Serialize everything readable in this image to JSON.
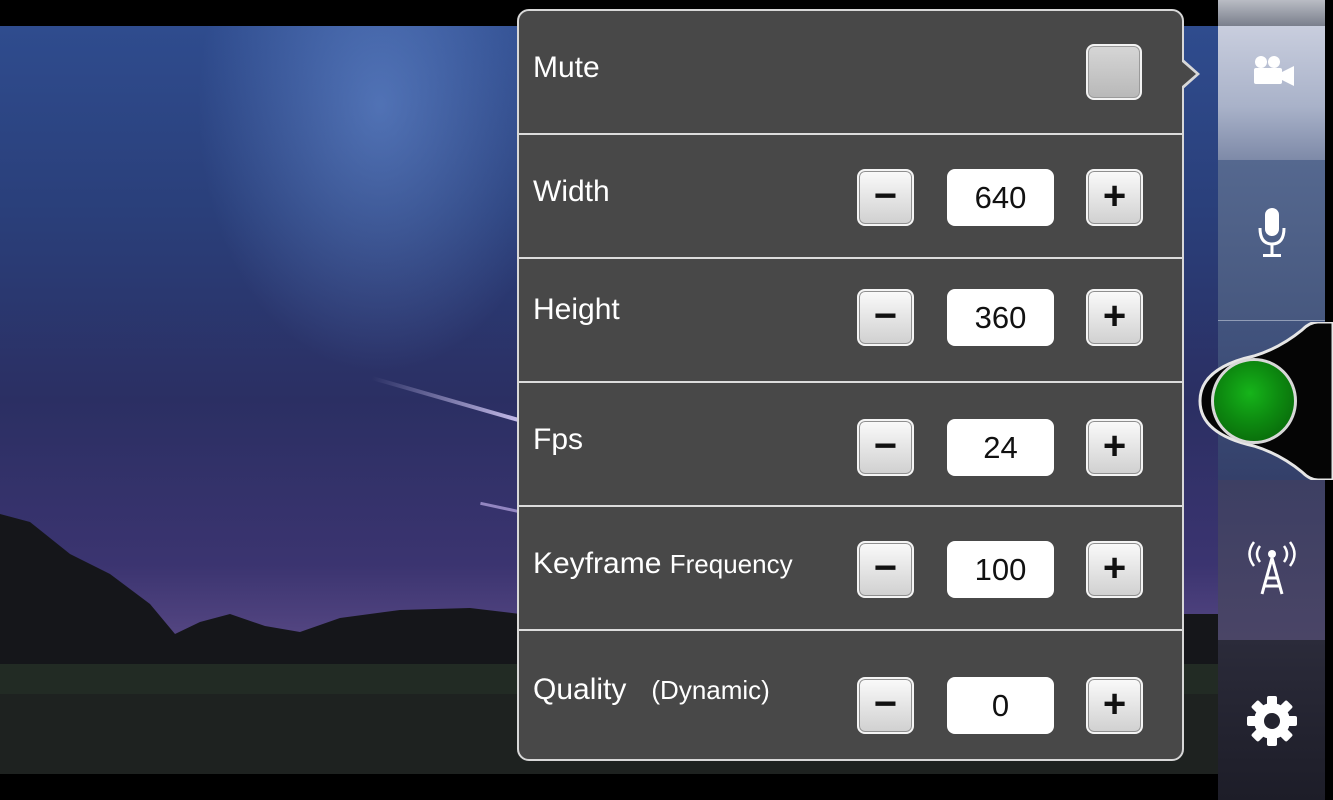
{
  "settings": {
    "mute": {
      "label": "Mute",
      "checked": false
    },
    "width": {
      "label": "Width",
      "value": "640",
      "minus": "−",
      "plus": "+"
    },
    "height": {
      "label": "Height",
      "value": "360",
      "minus": "−",
      "plus": "+"
    },
    "fps": {
      "label": "Fps",
      "value": "24",
      "minus": "−",
      "plus": "+"
    },
    "keyframe": {
      "label": "Keyframe",
      "label_small": "Frequency",
      "value": "100",
      "minus": "−",
      "plus": "+"
    },
    "quality": {
      "label": "Quality",
      "label_small": "(Dynamic)",
      "value": "0",
      "minus": "−",
      "plus": "+"
    }
  },
  "sidebar": {
    "items": [
      {
        "name": "video",
        "icon": "video-camera-icon",
        "selected": true
      },
      {
        "name": "audio",
        "icon": "microphone-icon",
        "selected": false
      },
      {
        "name": "record",
        "icon": "record-button",
        "color": "#0d8a10"
      },
      {
        "name": "broadcast",
        "icon": "antenna-icon",
        "selected": false
      },
      {
        "name": "settings",
        "icon": "gear-icon",
        "selected": false
      }
    ]
  }
}
